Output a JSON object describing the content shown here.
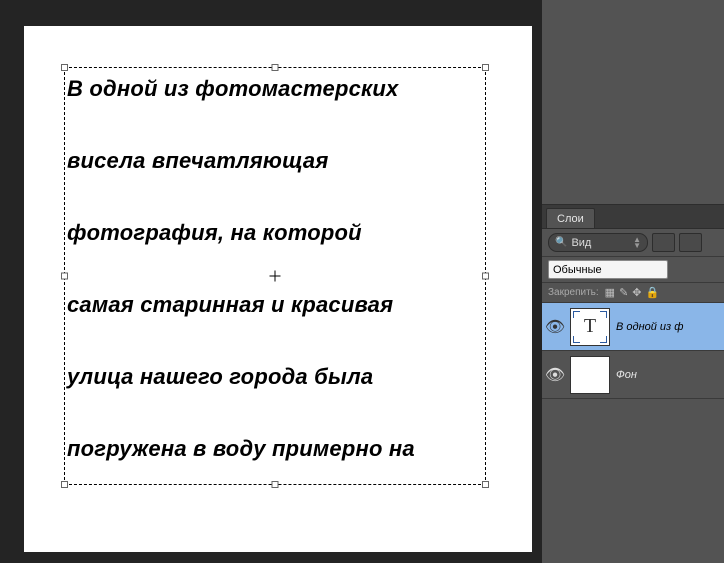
{
  "canvas_text": {
    "lines": [
      "В одной из фотомастерских",
      "висела впечатляющая",
      "фотография, на которой",
      "самая старинная и красивая",
      "улица нашего города была",
      "погружена в воду примерно на"
    ]
  },
  "panel": {
    "tab_label": "Слои",
    "filter_label": "Вид",
    "blend_mode": "Обычные",
    "lock_label": "Закрепить:",
    "layers": [
      {
        "name": "В одной из ф",
        "type": "text",
        "selected": true
      },
      {
        "name": "Фон",
        "type": "raster",
        "selected": false
      }
    ]
  }
}
